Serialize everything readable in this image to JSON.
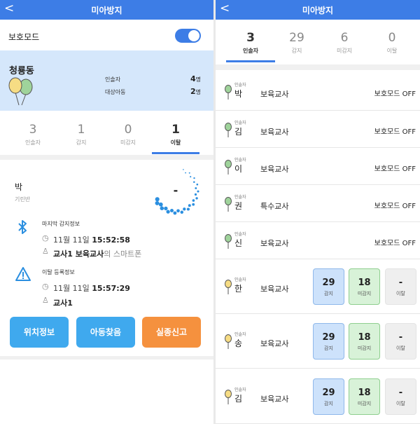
{
  "left": {
    "header": {
      "title": "미아방지",
      "back": "<"
    },
    "protect_mode": {
      "label": "보호모드",
      "on": true
    },
    "zone": {
      "name": "청룡동",
      "rows": [
        {
          "label": "인솔자",
          "value": "4",
          "unit": "명"
        },
        {
          "label": "대상아동",
          "value": "2",
          "unit": "명"
        }
      ]
    },
    "tabs": [
      {
        "num": "3",
        "label": "인솔자"
      },
      {
        "num": "1",
        "label": "감지"
      },
      {
        "num": "0",
        "label": "미감지"
      },
      {
        "num": "1",
        "label": "이탈"
      }
    ],
    "active_tab": 3,
    "child": {
      "name": "박",
      "class": "기린반",
      "dial": "-"
    },
    "last_detect": {
      "title": "마지막 감지정보",
      "date": "11월 11일",
      "time": "15:52:58",
      "who_bold": "교사1 보육교사",
      "who_suffix": "의 스마트폰"
    },
    "leave": {
      "title": "이탈 등록정보",
      "date": "11월 11일",
      "time": "15:57:29",
      "who_bold": "교사1"
    },
    "buttons": [
      {
        "label": "위치정보",
        "color": "#3fa9ee"
      },
      {
        "label": "아동찾음",
        "color": "#3fa9ee"
      },
      {
        "label": "실종신고",
        "color": "#f5913e"
      }
    ]
  },
  "right": {
    "header": {
      "title": "미아방지",
      "back": "<"
    },
    "tabs": [
      {
        "num": "3",
        "label": "인솔자"
      },
      {
        "num": "29",
        "label": "감지"
      },
      {
        "num": "6",
        "label": "미감지"
      },
      {
        "num": "0",
        "label": "이탈"
      }
    ],
    "active_tab": 0,
    "rows": [
      {
        "tag": "인솔자",
        "name": "박",
        "role": "보육교사",
        "status": "보호모드 OFF",
        "pin": "green"
      },
      {
        "tag": "인솔자",
        "name": "김",
        "role": "보육교사",
        "status": "보호모드 OFF",
        "pin": "green"
      },
      {
        "tag": "인솔자",
        "name": "이",
        "role": "보육교사",
        "status": "보호모드 OFF",
        "pin": "green"
      },
      {
        "tag": "인솔자",
        "name": "권",
        "role": "특수교사",
        "status": "보호모드 OFF",
        "pin": "green"
      },
      {
        "tag": "인솔자",
        "name": "신",
        "role": "보육교사",
        "status": "보호모드 OFF",
        "pin": "green"
      },
      {
        "tag": "인솔자",
        "name": "한",
        "role": "보육교사",
        "pin": "yellow",
        "boxes": [
          {
            "n": "29",
            "l": "감지"
          },
          {
            "n": "18",
            "l": "미감지"
          },
          {
            "n": "-",
            "l": "이탈"
          }
        ]
      },
      {
        "tag": "인솔자",
        "name": "송",
        "role": "보육교사",
        "pin": "yellow",
        "boxes": [
          {
            "n": "29",
            "l": "감지"
          },
          {
            "n": "18",
            "l": "미감지"
          },
          {
            "n": "-",
            "l": "이탈"
          }
        ]
      },
      {
        "tag": "인솔자",
        "name": "김",
        "role": "보육교사",
        "pin": "yellow",
        "boxes": [
          {
            "n": "29",
            "l": "감지"
          },
          {
            "n": "18",
            "l": "미감지"
          },
          {
            "n": "-",
            "l": "이탈"
          }
        ]
      }
    ]
  }
}
